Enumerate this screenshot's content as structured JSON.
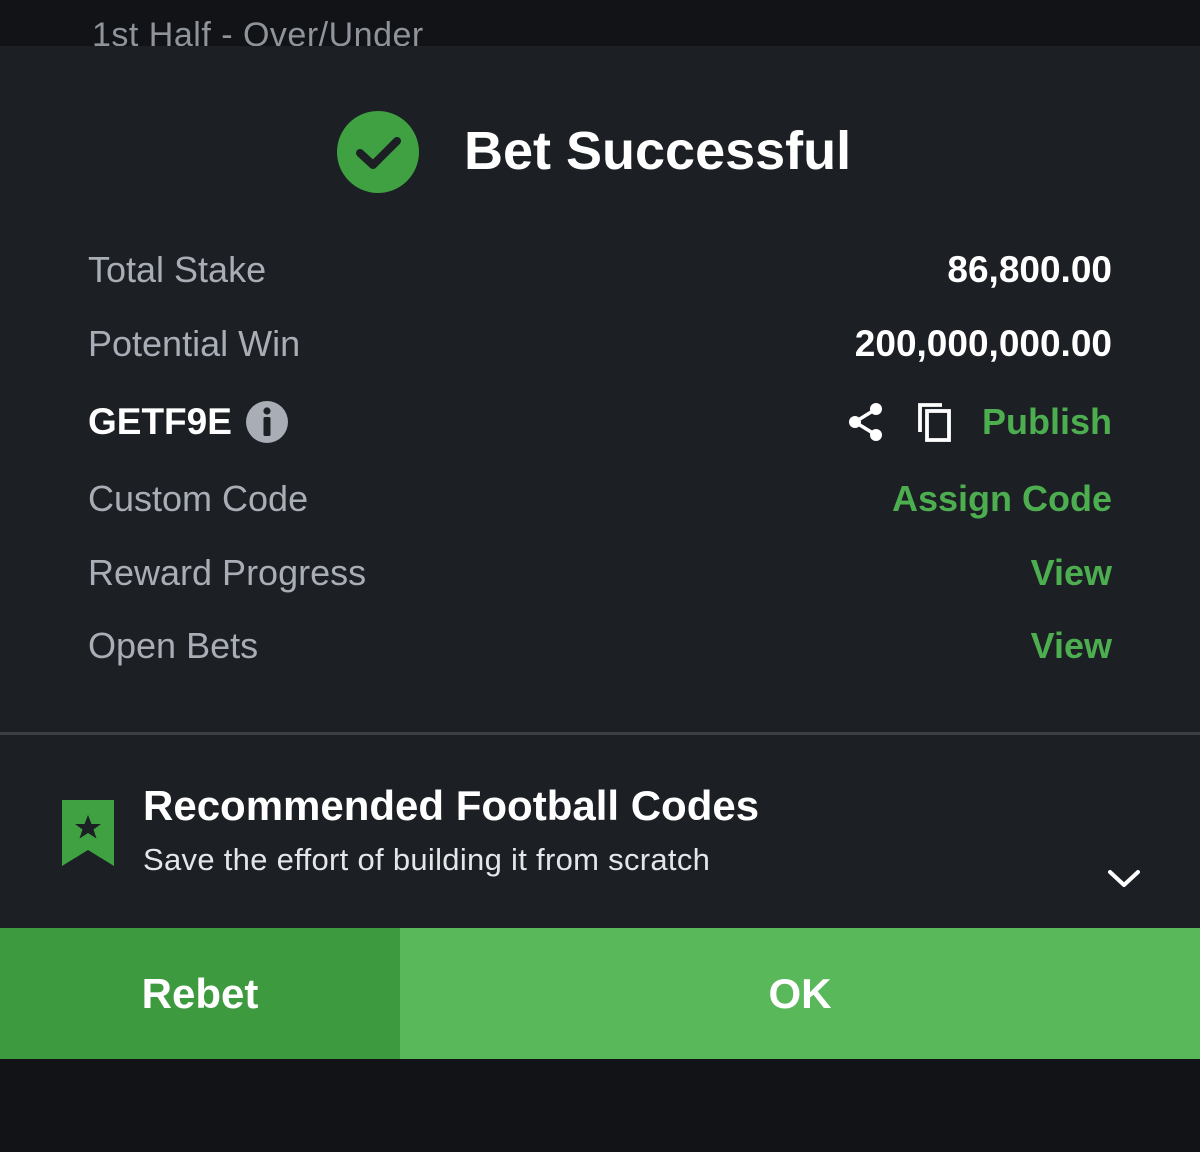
{
  "background": {
    "header_text": "1st Half - Over/Under"
  },
  "success": {
    "title": "Bet Successful",
    "icon": "check-circle-icon",
    "accent_color": "#3fa142"
  },
  "summary": {
    "total_stake_label": "Total Stake",
    "total_stake_value": "86,800.00",
    "potential_win_label": "Potential Win",
    "potential_win_value": "200,000,000.00",
    "booking_code": "GETF9E",
    "publish_label": "Publish",
    "custom_code_label": "Custom Code",
    "custom_code_action": "Assign Code",
    "reward_progress_label": "Reward Progress",
    "reward_progress_action": "View",
    "open_bets_label": "Open Bets",
    "open_bets_action": "View"
  },
  "recommended": {
    "title": "Recommended Football Codes",
    "subtitle": "Save the effort of building it from scratch"
  },
  "actions": {
    "rebet_label": "Rebet",
    "ok_label": "OK"
  },
  "colors": {
    "modal_bg": "#1c1f24",
    "link_green": "#4cae4f",
    "rebet_bg": "#3d9a3f",
    "ok_bg": "#58b85a"
  }
}
